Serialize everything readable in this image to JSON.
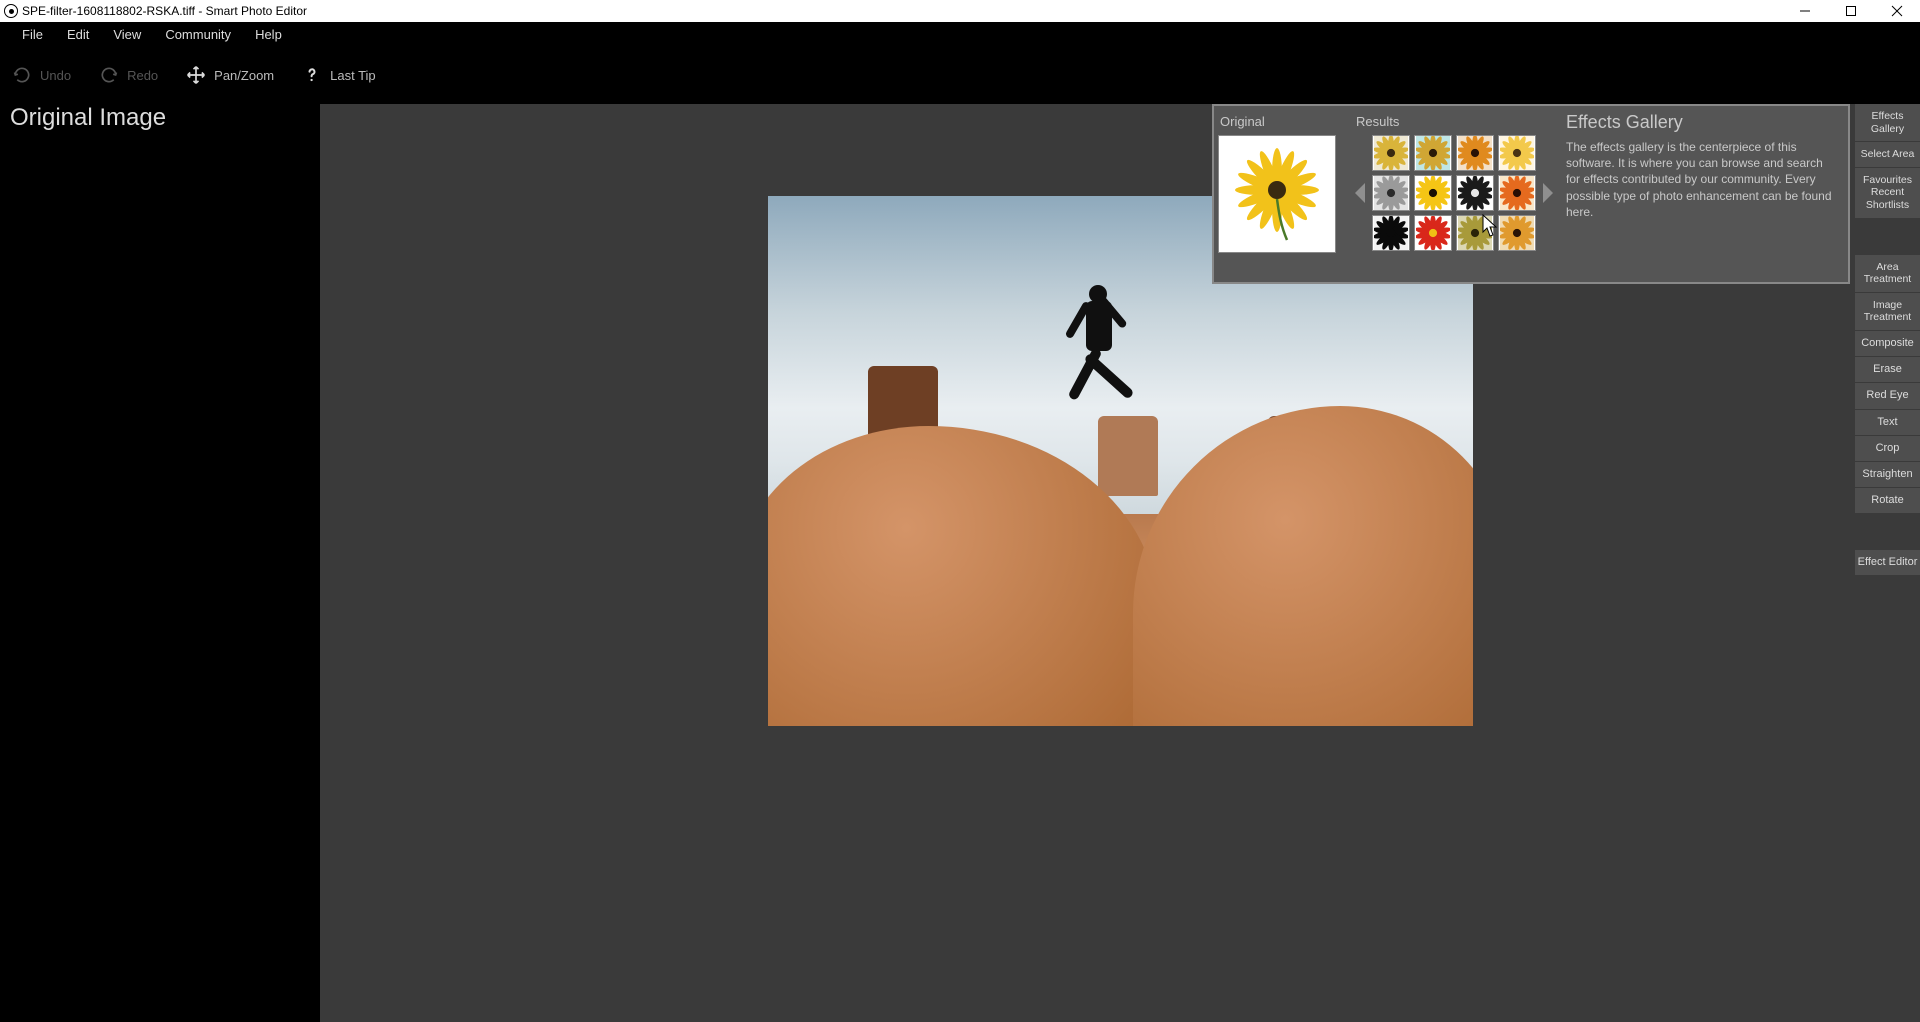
{
  "titlebar": {
    "text": "SPE-filter-1608118802-RSKA.tiff - Smart Photo Editor"
  },
  "menubar": {
    "items": [
      "File",
      "Edit",
      "View",
      "Community",
      "Help"
    ]
  },
  "toolbar": {
    "undo": "Undo",
    "redo": "Redo",
    "panzoom": "Pan/Zoom",
    "lasttip": "Last Tip"
  },
  "left_panel": {
    "heading": "Original Image"
  },
  "right_panel": {
    "group1": [
      "Effects Gallery",
      "Select Area",
      "Favourites Recent Shortlists"
    ],
    "group2": [
      "Area Treatment",
      "Image Treatment",
      "Composite",
      "Erase",
      "Red Eye",
      "Text",
      "Crop",
      "Straighten",
      "Rotate"
    ],
    "group3": [
      "Effect Editor"
    ]
  },
  "gallery_popup": {
    "original_label": "Original",
    "results_label": "Results",
    "title": "Effects Gallery",
    "description": "The effects gallery is the centerpiece of this software. It is where you can browse and search for effects contributed by our community.  Every possible type of photo enhancement can be found here.",
    "result_variants": [
      {
        "name": "vintage-yellow",
        "petal": "#d9b43a",
        "center": "#3a2a10",
        "bg": "#efe9d4"
      },
      {
        "name": "cool-teal",
        "petal": "#d0a634",
        "center": "#2a1a08",
        "bg": "#bfe6e6"
      },
      {
        "name": "warm-orange",
        "petal": "#e08a1e",
        "center": "#2a1206",
        "bg": "#f3e0c8"
      },
      {
        "name": "soft-glow",
        "petal": "#f3c94b",
        "center": "#4a3414",
        "bg": "#fff6e2"
      },
      {
        "name": "black-white",
        "petal": "#9a9a9a",
        "center": "#2a2a2a",
        "bg": "#e4e4e4"
      },
      {
        "name": "saturated-yellow",
        "petal": "#f5c515",
        "center": "#1a1004",
        "bg": "#ffffff"
      },
      {
        "name": "inverted-dark",
        "petal": "#1a1a1a",
        "center": "#e8e8e8",
        "bg": "#ffffff"
      },
      {
        "name": "red-orange",
        "petal": "#e56a1e",
        "center": "#2a0e04",
        "bg": "#f9e7c9"
      },
      {
        "name": "solid-black",
        "petal": "#0a0a0a",
        "center": "#0a0a0a",
        "bg": "#f4f4f4"
      },
      {
        "name": "fire-red",
        "petal": "#d9271a",
        "center": "#f0c015",
        "bg": "#ffffff"
      },
      {
        "name": "olive-tint",
        "petal": "#a89a3a",
        "center": "#2a2408",
        "bg": "#dcd8b4"
      },
      {
        "name": "orange-tint",
        "petal": "#e09a2e",
        "center": "#2a1406",
        "bg": "#f0dcb4"
      }
    ]
  }
}
